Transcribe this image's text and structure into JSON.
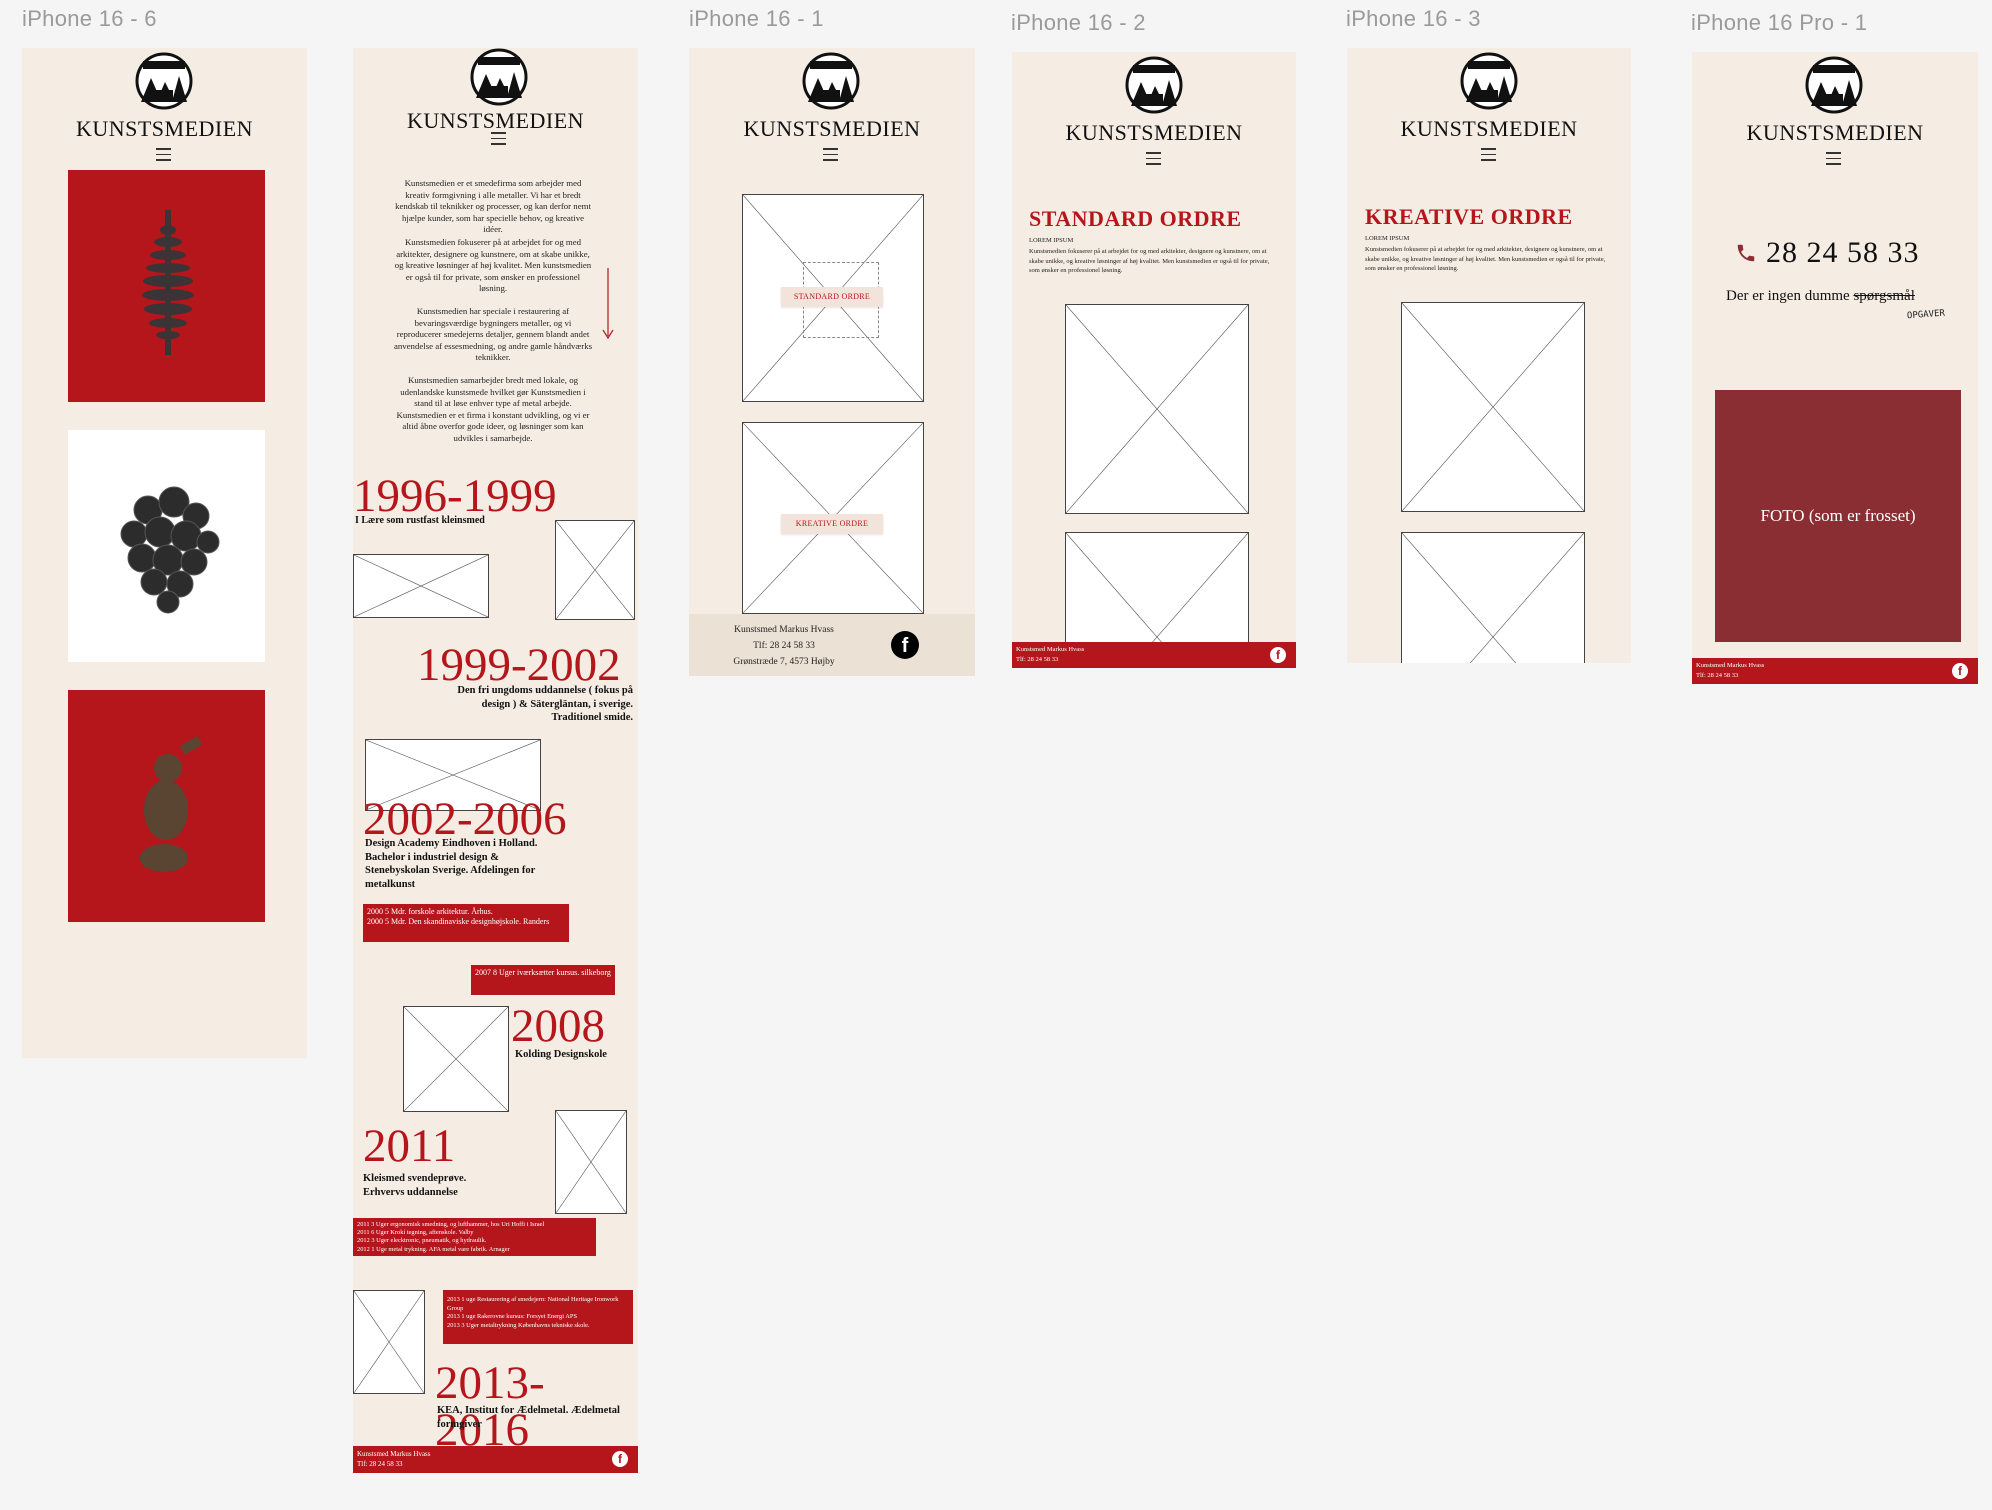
{
  "frames": {
    "f6": {
      "label": "iPhone 16 - 6"
    },
    "f1": {
      "label": "iPhone 16 - 1"
    },
    "f2": {
      "label": "iPhone 16 - 2"
    },
    "f3": {
      "label": "iPhone 16 - 3"
    },
    "fpro": {
      "label": "iPhone 16 Pro - 1"
    }
  },
  "brand": {
    "name": "KUNSTSMEDIEN",
    "logo_text": "HVASS METAL"
  },
  "about": {
    "p1": "Kunstsmedien er et smedefirma som arbejder med kreativ formgivning i alle metaller. Vi har et bredt kendskab til teknikker og processer, og kan derfor nemt hjælpe kunder, som har specielle behov, og kreative idéer.",
    "p2": "Kunstsmedien fokuserer på at arbejdet for og med arkitekter, designere og kunstnere, om at skabe unikke, og kreative løsninger af høj kvalitet. Men kunstsmedien er også til for private, som ønsker en professionel løsning.",
    "p3": "Kunstsmedien har speciale i restaurering af bevaringsværdige bygningers metaller, og vi reproducerer smedejerns detaljer, gennem blandt andet anvendelse af essesmedning, og andre gamle håndværks teknikker.",
    "p4": "Kunstsmedien samarbejder bredt med lokale, og udenlandske kunstsmede hvilket gør Kunstsmedien i stand til at løse enhver type af metal arbejde. Kunstsmedien er et firma i konstant udvikling, og vi er altid åbne overfor gode ideer, og løsninger som kan udvikles i samarbejde."
  },
  "timeline": {
    "y1": {
      "year": "1996-1999",
      "desc": "I Lære som rustfast kleinsmed"
    },
    "y2": {
      "year": "1999-2002",
      "desc": "Den fri ungdoms uddannelse ( fokus på design ) & Säterglän­tan, i sverige. Traditionel smide."
    },
    "y3": {
      "year": "2002-2006",
      "desc": "Design Academy Eindhoven i Holland. Bachelor i industriel design & Stenebyskolan Sverige. Afdelingen for metalkunst"
    },
    "box3": {
      "l1": "2000  5 Mdr.   forskole arkitektur. Århus.",
      "l2": "2000  5 Mdr.   Den skandinaviske designhøjskole. Randers"
    },
    "box4": {
      "l1": "2007  8 Uger   iværksætter kursus. silkeborg"
    },
    "y4": {
      "year": "2008",
      "desc": "Kolding Designskole"
    },
    "y5": {
      "year": "2011",
      "desc": "Kleismed svendeprøve. Erhvervs uddannelse"
    },
    "box5": {
      "l1": "2011  3 Uger   ergonomisk smedning, og lufthammer, hos Uri Hoffi i Israel",
      "l2": "2011  6 Uger   Krokí tegning, aftenskole. Valby",
      "l3": "2012  3 Uger   elecktronic, pneumatik, og hydraulik.",
      "l4": "2012  1 Uge     metal trykning. AFA metal vare fabrik. Arnager"
    },
    "box6": {
      "l1": "2013  1 uge     Restaurering af smedejern: National Heritage Ironwork Group",
      "l2": "2013  1 uge     Rakerovne kursus: Forsyet Energi APS",
      "l3": "2013  3 Uger   metaltrykning Københavns tekniske skole."
    },
    "y6": {
      "year": "2013-2016",
      "desc": "KEA, Institut for Ædelmetal. Ædelmetal formgiver"
    }
  },
  "footer": {
    "name": "Kunstsmed Markus Hvass",
    "phone": "Tlf: 28 24 58 33",
    "address": "Grønstræde 7, 4573 Højby",
    "social_icon": "facebook-icon"
  },
  "orders": {
    "standard_btn": "STANDARD ORDRE",
    "kreative_btn": "KREATIVE ORDRE",
    "standard_title": "STANDARD ORDRE",
    "kreative_title": "KREATIVE ORDRE",
    "lorem": "LOREM IPSUM",
    "order_text": "Kunstsmedien fokuserer på at arbejdet for og med arkitekter, designere og kunstnere, om at skabe unikke, og kreative løsninger af høj kvalitet. Men kunstsmedien er også til for private, som ønsker en professionel løsning."
  },
  "contact": {
    "phone": "28 24 58 33",
    "tagline_start": "Der er ingen dumme",
    "struck_word": "spørgsmål",
    "handwritten": "OPGAVER",
    "photo_placeholder": "FOTO (som er frosset)"
  },
  "colors": {
    "accent": "#b5161c",
    "background": "#f5ede4",
    "canvas": "#f5f5f5",
    "photo_block": "#8b2e34"
  }
}
